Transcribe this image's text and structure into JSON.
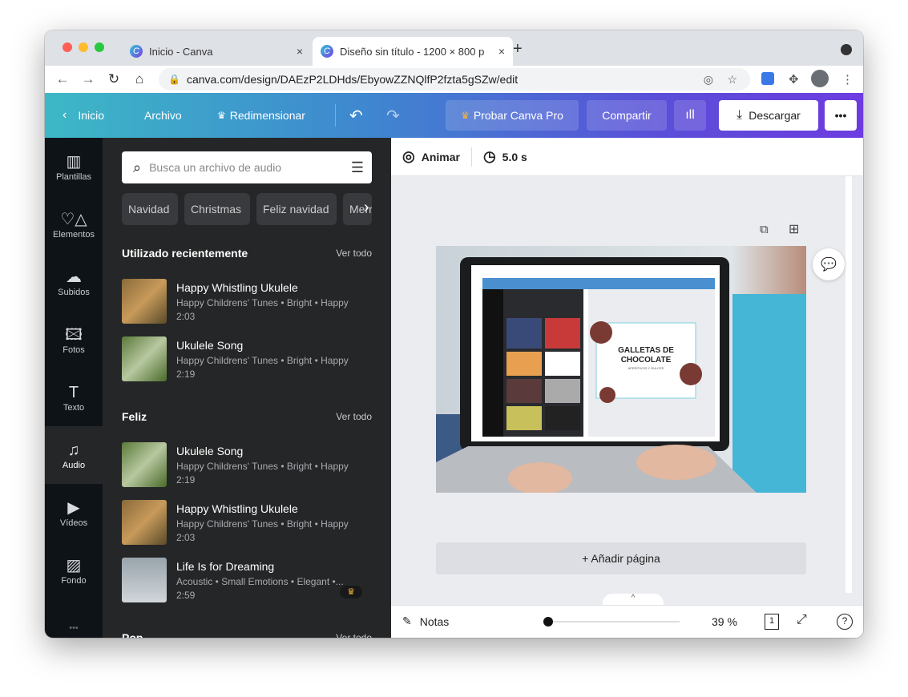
{
  "browser": {
    "tabs": [
      {
        "title": "Inicio - Canva"
      },
      {
        "title": "Diseño sin título - 1200 × 800 p"
      }
    ],
    "url": "canva.com/design/DAEzP2LDHds/EbyowZZNQlfP2fzta5gSZw/edit",
    "close": "×",
    "new_tab": "+"
  },
  "header": {
    "home": "Inicio",
    "file": "Archivo",
    "resize": "Redimensionar",
    "try_pro": "Probar Canva Pro",
    "share": "Compartir",
    "download": "Descargar",
    "more": "•••"
  },
  "rail": [
    {
      "label": "Plantillas",
      "icon": "▥"
    },
    {
      "label": "Elementos",
      "icon": "♡△"
    },
    {
      "label": "Subidos",
      "icon": "☁"
    },
    {
      "label": "Fotos",
      "icon": "🖾"
    },
    {
      "label": "Texto",
      "icon": "T"
    },
    {
      "label": "Audio",
      "icon": "♫"
    },
    {
      "label": "Vídeos",
      "icon": "▶"
    },
    {
      "label": "Fondo",
      "icon": "▨"
    },
    {
      "label": "•••",
      "icon": ""
    }
  ],
  "panel": {
    "search_placeholder": "Busca un archivo de audio",
    "chips": [
      "Navidad",
      "Christmas",
      "Feliz navidad",
      "Merry"
    ],
    "sections": [
      {
        "title": "Utilizado recientemente",
        "see_all": "Ver todo",
        "tracks": [
          {
            "title": "Happy Whistling Ukulele",
            "meta": "Happy Childrens' Tunes • Bright • Happy",
            "duration": "2:03"
          },
          {
            "title": "Ukulele Song",
            "meta": "Happy Childrens' Tunes • Bright • Happy",
            "duration": "2:19"
          }
        ]
      },
      {
        "title": "Feliz",
        "see_all": "Ver todo",
        "tracks": [
          {
            "title": "Ukulele Song",
            "meta": "Happy Childrens' Tunes • Bright • Happy",
            "duration": "2:19"
          },
          {
            "title": "Happy Whistling Ukulele",
            "meta": "Happy Childrens' Tunes • Bright • Happy",
            "duration": "2:03"
          },
          {
            "title": "Life Is for Dreaming",
            "meta": "Acoustic • Small Emotions • Elegant •...",
            "duration": "2:59",
            "pro": true
          }
        ]
      },
      {
        "title": "Pop",
        "see_all": "Ver todo"
      }
    ]
  },
  "toolbar": {
    "animate": "Animar",
    "duration": "5.0 s"
  },
  "canvas": {
    "design_title_line1": "GALLETAS DE",
    "design_title_line2": "CHOCOLATE",
    "design_subtitle": "APERITIVOS Y DULCES",
    "add_page": "+ Añadir página"
  },
  "bottom": {
    "notes": "Notas",
    "zoom": "39 %",
    "zoom_percent": 39,
    "page_count": "1"
  },
  "colors": {
    "header_start": "#3db8c6",
    "header_end": "#6d3ce0",
    "panel": "#252627",
    "rail": "#0e1318",
    "canvas_bg": "#ebecf0",
    "crown": "#f5b23c"
  }
}
